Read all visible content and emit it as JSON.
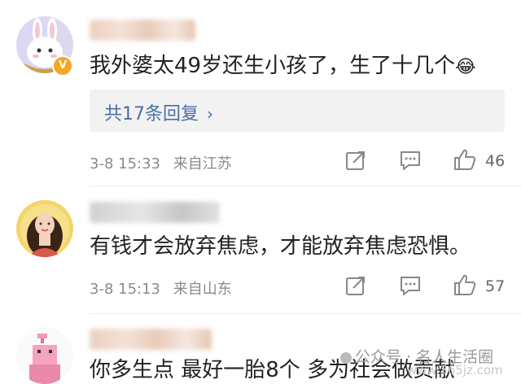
{
  "comments": [
    {
      "text": "我外婆太49岁还生小孩了，生了十几个",
      "emoji": "😂",
      "replies_label": "共17条回复",
      "date": "3-8 15:33",
      "location": "来自江苏",
      "likes": "46"
    },
    {
      "text": "有钱才会放弃焦虑，才能放弃焦虑恐惧。",
      "date": "3-8 15:13",
      "location": "来自山东",
      "likes": "57"
    },
    {
      "text": "你多生点 最好一胎8个 多为社会做贡献"
    }
  ],
  "watermark": {
    "label": "公众号 · 名人生活圈",
    "site": "www.365jz.com"
  },
  "colors": {
    "link": "#4a6fa5",
    "meta": "#8a8a8a",
    "reply_bg": "#f2f2f2",
    "verified": "#f5a623"
  }
}
